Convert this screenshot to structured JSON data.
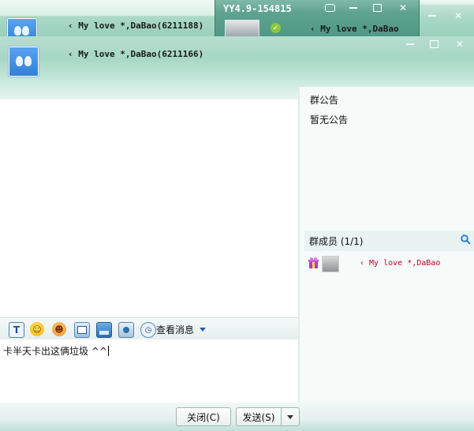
{
  "back_window": {
    "title": "‹ My love *,DaBao(6211188)"
  },
  "mid_window": {
    "title": "YY4.9-154815",
    "contact": "‹ My love *,DaBao"
  },
  "front_window": {
    "title": "‹ My love *,DaBao(6211166)"
  },
  "right_panel": {
    "announcement_title": "群公告",
    "announcement_body": "暂无公告",
    "members_title": "群成员 (1/1)",
    "member_name": "‹ My love *,DaBao"
  },
  "toolbar": {
    "font_label": "T",
    "view_messages": "查看消息"
  },
  "input": {
    "text": "卡半天卡出这俩垃圾 ^^"
  },
  "buttons": {
    "close": "关闭(C)",
    "send": "发送(S)"
  },
  "colors": {
    "member_name": "#c0002a",
    "header_teal": "#8fcab3",
    "accent_blue": "#2f7fd6"
  }
}
